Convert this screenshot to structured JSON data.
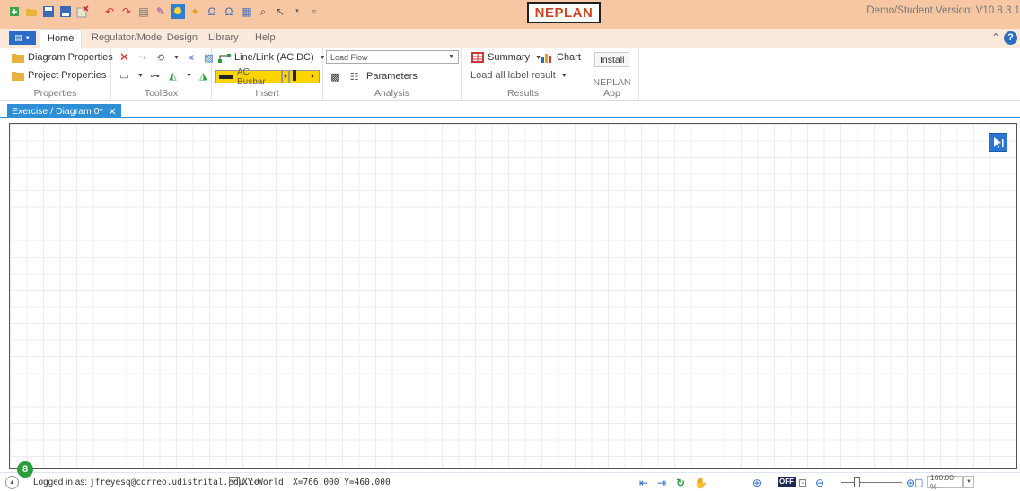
{
  "app": {
    "logo": "NEPLAN",
    "version": "Demo/Student Version: V10.8.3.1"
  },
  "menu": {
    "tabs": [
      "Home",
      "Regulator/Model Design",
      "Library",
      "Help"
    ]
  },
  "ribbon": {
    "properties": {
      "diagram_properties": "Diagram Properties",
      "project_properties": "Project Properties",
      "title": "Properties"
    },
    "toolbox": {
      "title": "ToolBox"
    },
    "insert": {
      "line_link": "Line/Link (AC,DC)",
      "ac_busbar": "AC Busbar",
      "title": "Insert"
    },
    "analysis": {
      "mode": "Load Flow",
      "parameters": "Parameters",
      "title": "Analysis"
    },
    "results": {
      "summary": "Summary",
      "chart": "Chart",
      "load_all": "Load all label result",
      "title": "Results"
    },
    "neplan_app": {
      "install": "Install",
      "title": "NEPLAN App"
    }
  },
  "document": {
    "tab_label": "Exercise / Diagram 0*"
  },
  "status": {
    "badge_count": "8",
    "login_prefix": "Logged in as:",
    "login_email": "jfreyesq@correo.udistrital.edu.co",
    "xy_world": "XY-World",
    "coords": "X=766.000 Y=460.000",
    "zoom": "100.00 %"
  },
  "colors": {
    "title_bg": "#f7c7a3",
    "accent": "#2f8fd6",
    "file_button": "#2b6cc4",
    "busbar": "#ffd400",
    "badge": "#2a9d3c"
  }
}
